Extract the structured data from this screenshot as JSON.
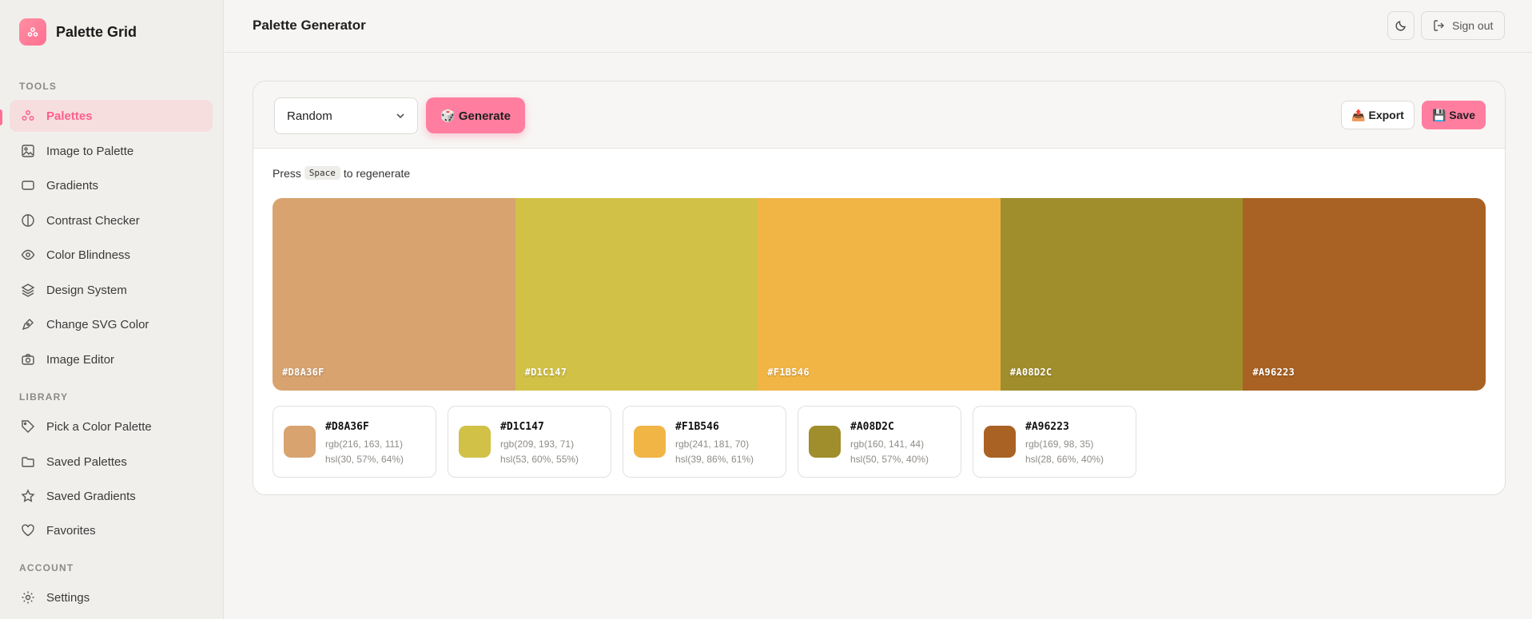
{
  "app": {
    "name": "Palette Grid"
  },
  "sidebar": {
    "sections": [
      "TOOLS",
      "LIBRARY",
      "ACCOUNT"
    ],
    "tools": [
      {
        "label": "Palettes",
        "icon": "palette-icon",
        "active": true
      },
      {
        "label": "Image to Palette",
        "icon": "image-icon"
      },
      {
        "label": "Gradients",
        "icon": "rectangle-icon"
      },
      {
        "label": "Contrast Checker",
        "icon": "contrast-icon"
      },
      {
        "label": "Color Blindness",
        "icon": "eye-icon"
      },
      {
        "label": "Design System",
        "icon": "layers-icon"
      },
      {
        "label": "Change SVG Color",
        "icon": "pen-icon"
      },
      {
        "label": "Image Editor",
        "icon": "camera-icon"
      }
    ],
    "library": [
      {
        "label": "Pick a Color Palette",
        "icon": "tag-icon"
      },
      {
        "label": "Saved Palettes",
        "icon": "folder-icon"
      },
      {
        "label": "Saved Gradients",
        "icon": "star-icon"
      },
      {
        "label": "Favorites",
        "icon": "heart-icon"
      }
    ],
    "account": [
      {
        "label": "Settings",
        "icon": "gear-icon"
      }
    ]
  },
  "header": {
    "title": "Palette Generator",
    "signout_label": "Sign out",
    "theme_icon": "moon-icon"
  },
  "toolbar": {
    "mode_value": "Random",
    "generate_label": "🎲 Generate",
    "export_label": "📤 Export",
    "save_label": "💾 Save"
  },
  "hint": {
    "before": "Press",
    "key": "Space",
    "after": "to regenerate"
  },
  "palette": [
    {
      "hex": "#D8A36F",
      "rgb": "rgb(216, 163, 111)",
      "hsl": "hsl(30, 57%, 64%)"
    },
    {
      "hex": "#D1C147",
      "rgb": "rgb(209, 193, 71)",
      "hsl": "hsl(53, 60%, 55%)"
    },
    {
      "hex": "#F1B546",
      "rgb": "rgb(241, 181, 70)",
      "hsl": "hsl(39, 86%, 61%)"
    },
    {
      "hex": "#A08D2C",
      "rgb": "rgb(160, 141, 44)",
      "hsl": "hsl(50, 57%, 40%)"
    },
    {
      "hex": "#A96223",
      "rgb": "rgb(169, 98, 35)",
      "hsl": "hsl(28, 66%, 40%)"
    }
  ],
  "colors": {
    "accent": "#FF7EA0",
    "active_text": "#FF5F8A"
  }
}
